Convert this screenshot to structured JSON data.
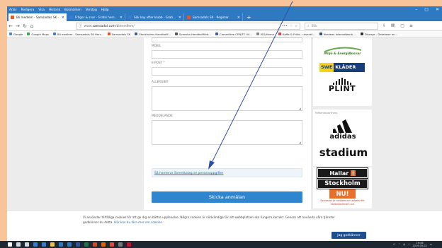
{
  "browser": {
    "menu": [
      "Arkiv",
      "Redigera",
      "Visa",
      "Historik",
      "Bokmärken",
      "Verktyg",
      "Hjälp"
    ],
    "window_controls": [
      "–",
      "▢",
      "✕"
    ],
    "tabs": [
      {
        "title": "Bli medlem - Samsadals SK - ",
        "color": "#e7542a"
      },
      {
        "title": "Frågor & svar - Gratis hemsid",
        "color": "#3a7bd5"
      },
      {
        "title": "Sök kay efter klubb - Gratis hem",
        "color": "#3a7bd5"
      },
      {
        "title": "Samsadals SK - Register",
        "color": "#e7542a"
      }
    ],
    "new_tab": "+",
    "url_prefix": "www.",
    "url_domain": "samsadal.com",
    "url_path": "/blimedlem/",
    "url_actions": [
      "•••",
      "♡",
      "☆"
    ],
    "search_placeholder": "Sök",
    "tools": [
      "⇩",
      "Ⅲ\\",
      "▢",
      "≡"
    ],
    "bookmarks": [
      {
        "label": "Google",
        "color": "#4285f4"
      },
      {
        "label": "Google Maps",
        "color": "#34a853"
      },
      {
        "label": "Bli medlem - Samsadals SK Herr...",
        "color": "#3a7bd5"
      },
      {
        "label": "Samsadals SK",
        "color": "#e7542a"
      },
      {
        "label": "Stockholms Handbollf...",
        "color": "#3a5fa8"
      },
      {
        "label": "Svenska Handbollförb...",
        "color": "#555"
      },
      {
        "label": "Committee CEN/TC 44...",
        "color": "#3a5fa8"
      },
      {
        "label": "ISO/Home",
        "color": "#888"
      },
      {
        "label": "Kaffe & Fritid - utveckl...",
        "color": "#d44"
      },
      {
        "label": "Nordeas Internetbank ...",
        "color": "#1f4f8f"
      },
      {
        "label": "Discogs - Database an...",
        "color": "#333"
      }
    ]
  },
  "form": {
    "mobil_label": "MOBIL",
    "epost_label": "E-POST *",
    "allergier_label": "ALLERGIER",
    "meddelande_label": "MEDDELANDE",
    "privacy_link": "Så hanterar Svenskalag.se personuppgifter",
    "submit_label": "Skicka anmälan"
  },
  "sidebar": {
    "sponsor_label": "Materialpartners",
    "brands": {
      "miljo": "Miljö & EnergiAnsvar",
      "swe": "SWE",
      "klader": "KLÄDER",
      "plint": "PLINT",
      "adidas": "adidas",
      "stadium": "stadium",
      "hallar_1": "Hallar",
      "hallar_i": "i",
      "hallar_2": "Stockholm",
      "nu": "NU!",
      "hallar_sub": "Samsadal är medlem och arbetar för hallarstockholm.nu!"
    }
  },
  "cookie": {
    "text_1": "Vi använder tillfälliga cookies för att ge dig en bättre upplevelse. Några cookies är nödvändiga för att webbplatsen ska fungera korrekt. Genom att använda våra tjänster",
    "text_2": "godkänner du detta.",
    "link": "Här kan du läsa mer om cookies",
    "accept": "Jag godkänner"
  },
  "taskbar": {
    "apps": [
      {
        "icon": "windows-icon",
        "color": "#ffffff"
      },
      {
        "icon": "search-icon",
        "color": "#cfd8dc"
      },
      {
        "icon": "task-view-icon",
        "color": "#cfd8dc"
      },
      {
        "icon": "edge-icon",
        "color": "#3a7bd5"
      },
      {
        "icon": "store-icon",
        "color": "#3a7bd5"
      },
      {
        "icon": "file-explorer-icon",
        "color": "#f0c040"
      },
      {
        "icon": "mail-icon",
        "color": "#2f79c2"
      },
      {
        "icon": "outlook-icon",
        "color": "#2f79c2"
      },
      {
        "icon": "word-icon",
        "color": "#2b579a"
      },
      {
        "icon": "excel-icon",
        "color": "#217346"
      },
      {
        "icon": "powerpoint-icon",
        "color": "#d24726"
      },
      {
        "icon": "firefox-icon",
        "color": "#e66000"
      },
      {
        "icon": "chrome-icon",
        "color": "#dd4b39"
      },
      {
        "icon": "calculator-icon",
        "color": "#777777"
      },
      {
        "icon": "acrobat-icon",
        "color": "#c8102e"
      }
    ],
    "time": "19:46",
    "date": "2019-05-02"
  }
}
